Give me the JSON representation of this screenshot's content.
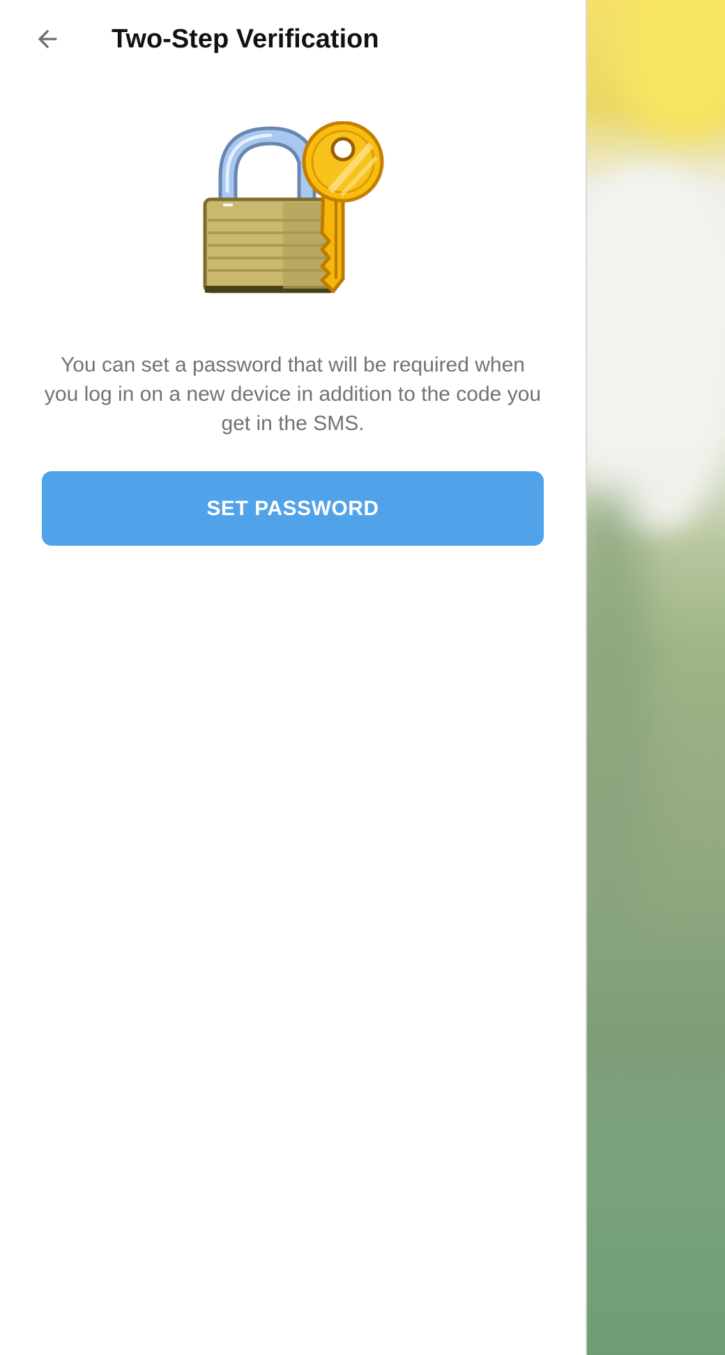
{
  "header": {
    "title": "Two-Step Verification",
    "back_icon": "arrow-left-icon"
  },
  "illustration": {
    "icon": "locked-padlock-with-key-icon"
  },
  "main": {
    "description": "You can set a password that will be required when you log in on a new device in addition to the code you get in the SMS.",
    "set_password_label": "SET PASSWORD"
  },
  "colors": {
    "accent": "#50a2e9",
    "title_text": "#111111",
    "description_text": "#6f7277",
    "background": "#ffffff"
  }
}
